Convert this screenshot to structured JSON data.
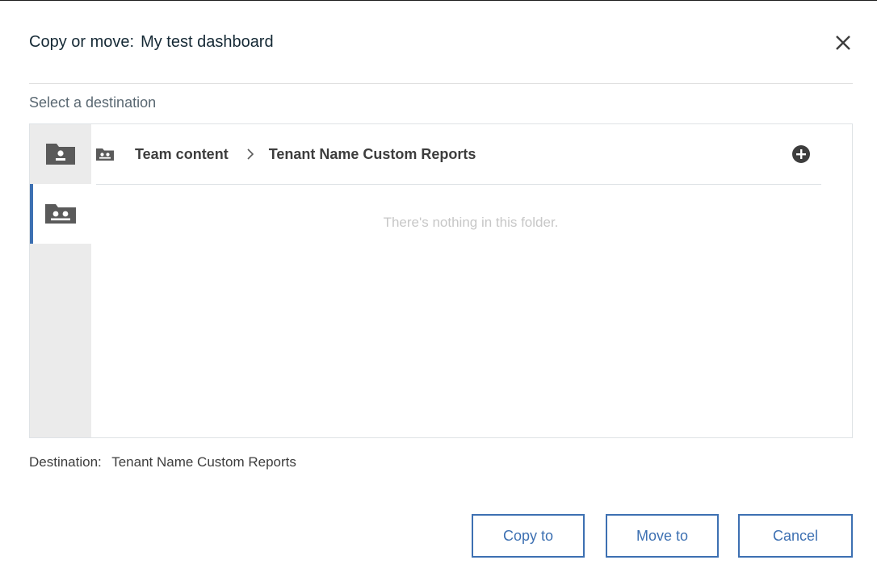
{
  "dialog": {
    "title_prefix": "Copy or move:",
    "title_item": "My test dashboard",
    "close_icon": "close-icon"
  },
  "select_label": "Select a destination",
  "sidenav": {
    "items": [
      {
        "icon": "personal-folder-icon",
        "selected": false
      },
      {
        "icon": "team-folder-icon",
        "selected": true
      }
    ]
  },
  "breadcrumb": {
    "icon": "team-folder-icon",
    "items": [
      "Team content",
      "Tenant Name Custom Reports"
    ],
    "separator_icon": "chevron-right-icon"
  },
  "add_icon": "add-circle-icon",
  "empty_message": "There's nothing in this folder.",
  "destination": {
    "label": "Destination:",
    "value": "Tenant Name Custom Reports"
  },
  "buttons": {
    "copy": "Copy to",
    "move": "Move to",
    "cancel": "Cancel"
  },
  "colors": {
    "accent": "#3d70b2",
    "icon": "#5a5a5a",
    "sidenav_bg": "#ebebeb",
    "muted_text": "#c7c7c7"
  }
}
